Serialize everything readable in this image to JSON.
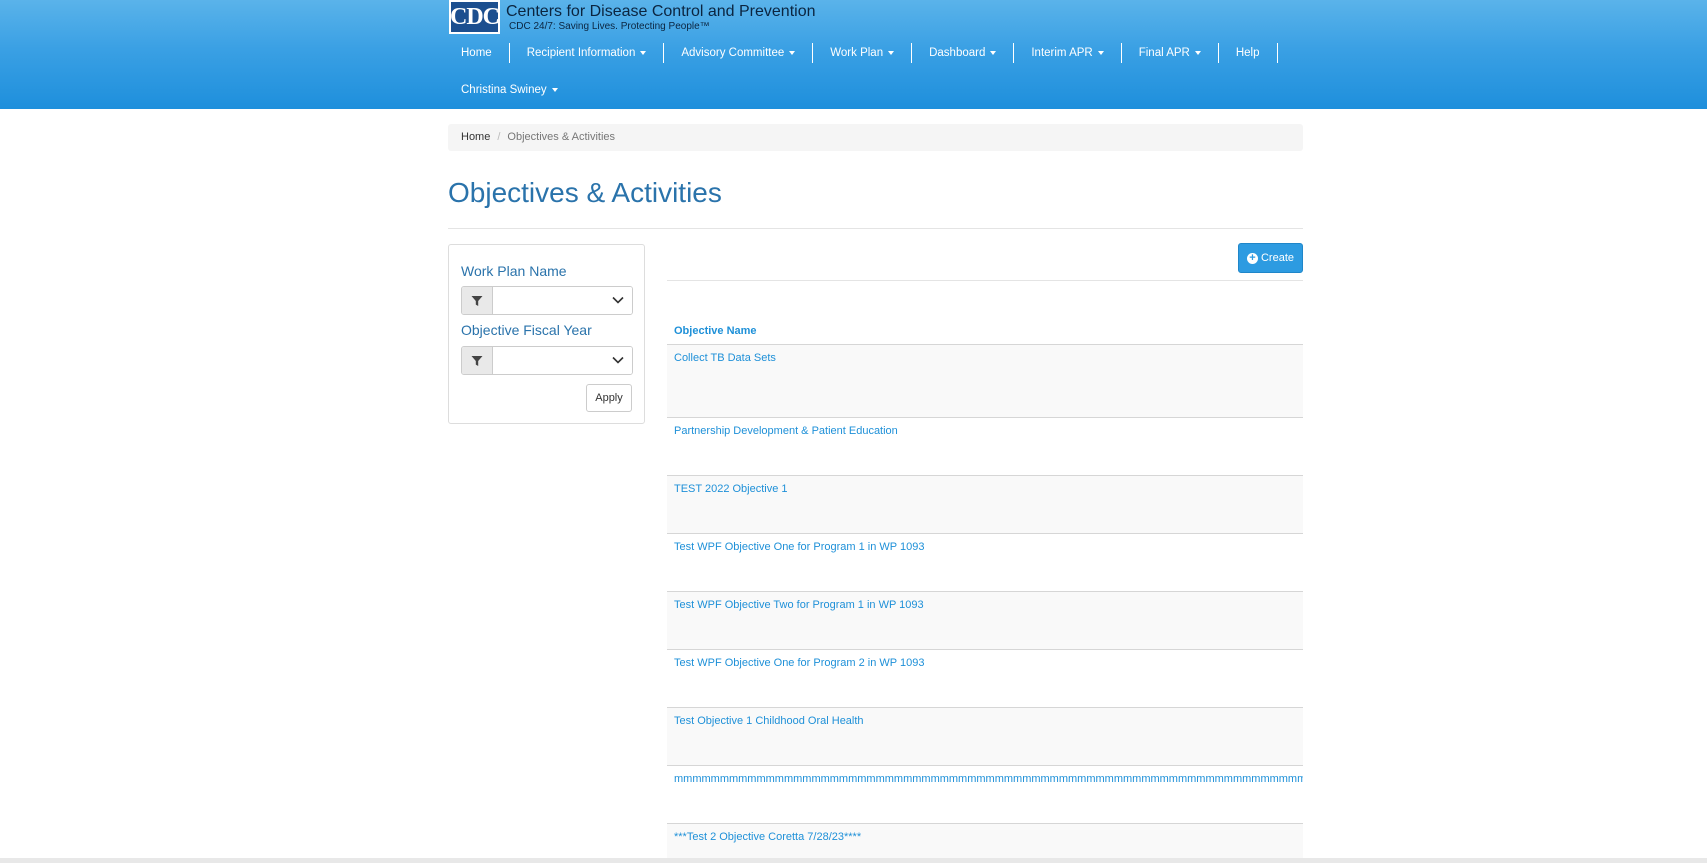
{
  "brand": {
    "logo_text": "CDC",
    "title": "Centers for Disease Control and Prevention",
    "subtitle": "CDC 24/7: Saving Lives. Protecting People™"
  },
  "nav": {
    "row1": [
      {
        "label": "Home",
        "dropdown": false
      },
      {
        "label": "Recipient Information",
        "dropdown": true
      },
      {
        "label": "Advisory Committee",
        "dropdown": true
      },
      {
        "label": "Work Plan",
        "dropdown": true
      },
      {
        "label": "Dashboard",
        "dropdown": true
      },
      {
        "label": "Interim APR",
        "dropdown": true
      },
      {
        "label": "Final APR",
        "dropdown": true
      },
      {
        "label": "Help",
        "dropdown": false
      }
    ],
    "user": {
      "label": "Christina Swiney",
      "dropdown": true
    }
  },
  "breadcrumb": {
    "home": "Home",
    "separator": "/",
    "current": "Objectives & Activities"
  },
  "page": {
    "title": "Objectives & Activities"
  },
  "filters": {
    "work_plan_label": "Work Plan Name",
    "work_plan_value": "",
    "fiscal_year_label": "Objective Fiscal Year",
    "fiscal_year_value": "",
    "apply_label": "Apply"
  },
  "toolbar": {
    "create_label": "Create"
  },
  "grid": {
    "column_header": "Objective Name",
    "rows": [
      "Collect TB Data Sets",
      "Partnership Development & Patient Education",
      "TEST 2022 Objective 1",
      "Test WPF Objective One for Program 1 in WP 1093",
      "Test WPF Objective Two for Program 1 in WP 1093",
      "Test WPF Objective One for Program 2 in WP 1093",
      "Test Objective 1 Childhood Oral Health",
      "mmmmmmmmmmmmmmmmmmmmmmmmmmmmmmmmmmmmmmmmmmmmmmmmmmmmmmmmmmmmmmmmmmmmmmmmmmmmmmmmmmmmmmmmmmmmmmmmmm",
      "***Test 2 Objective Coretta 7/28/23****"
    ]
  },
  "colors": {
    "header_top": "#5ab3ea",
    "header_bottom": "#1e8fdc",
    "title_blue": "#2a73ab",
    "link_blue": "#1e90d8",
    "create_button": "#2d9be1"
  }
}
